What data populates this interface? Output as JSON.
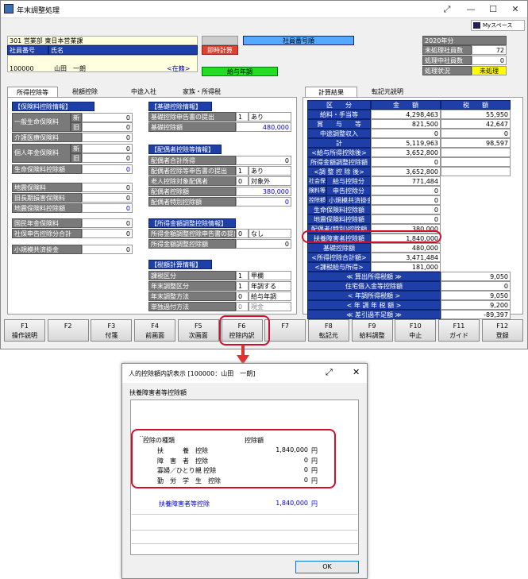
{
  "window": {
    "title": "年末調整処理",
    "myspace": "Myスペース",
    "expand": "⤢",
    "minimize": "—",
    "maximize": "☐",
    "close": "✕"
  },
  "employee": {
    "dept": "301 営業部 東日本営業課",
    "no_label": "社員番号",
    "name_label": "氏名",
    "no": "100000",
    "name": "山田　一朗",
    "status_link": "<在籍>",
    "instant_calc": "即時計算",
    "sort_label": "社員番号順",
    "salary_adjust": "給与年調"
  },
  "summary": {
    "year": "2020年分",
    "rows": [
      {
        "label": "未処理社員数",
        "value": "72"
      },
      {
        "label": "処理中社員数",
        "value": "0"
      },
      {
        "label": "処理状況",
        "value": "未処理"
      }
    ]
  },
  "tabs": [
    "所得控除等",
    "税額控除",
    "中途入社",
    "家族・所得税"
  ],
  "right_tabs": [
    "計算結果",
    "転記元説明"
  ],
  "insurance": {
    "header": "【保険料控除情報】",
    "rows": [
      {
        "label": "一般生命保険料",
        "sub": "新",
        "value": "0"
      },
      {
        "label": "",
        "sub": "旧",
        "value": "0"
      },
      {
        "label": "介護医療保険料",
        "sub": "",
        "value": "0"
      },
      {
        "label": "個人年金保険料",
        "sub": "新",
        "value": "0"
      },
      {
        "label": "",
        "sub": "旧",
        "value": "0"
      },
      {
        "label": "生命保険料控除額",
        "sub": "",
        "value": "0"
      }
    ],
    "eq": [
      {
        "label": "地震保険料",
        "value": "0"
      },
      {
        "label": "旧長期損害保険料",
        "value": "0"
      },
      {
        "label": "地震保険料控除額",
        "value": "0"
      }
    ],
    "ss": [
      {
        "label": "国民年金保険料",
        "value": "0"
      },
      {
        "label": "社保申告控除分合計",
        "value": "0"
      }
    ],
    "small": {
      "label": "小規模共済掛金",
      "value": "0"
    }
  },
  "basic": {
    "header": "【基礎控除情報】",
    "rows": [
      {
        "label": "基礎控除申告書の提出",
        "code": "1",
        "text": "あり"
      },
      {
        "label": "基礎控除額",
        "code": "",
        "text": "480,000"
      }
    ]
  },
  "spouse": {
    "header": "【配偶者控除等情報】",
    "rows": [
      {
        "label": "配偶者合計所得",
        "code": "",
        "text": "0"
      },
      {
        "label": "配偶者控除等申告書の提出",
        "code": "1",
        "text": "あり"
      },
      {
        "label": "老人控除対象配偶者",
        "code": "0",
        "text": "対象外"
      },
      {
        "label": "配偶者控除額",
        "code": "",
        "text": "380,000"
      },
      {
        "label": "配偶者特別控除額",
        "code": "",
        "text": "0"
      }
    ]
  },
  "income_adj": {
    "header": "【所得金額調整控除情報】",
    "rows": [
      {
        "label": "所得金額調整控除申告書の提出",
        "code": "0",
        "text": "なし"
      },
      {
        "label": "所得金額調整控除額",
        "code": "",
        "text": "0"
      }
    ]
  },
  "tax_calc": {
    "header": "【税額計算情報】",
    "rows": [
      {
        "label": "課税区分",
        "code": "1",
        "text": "甲欄"
      },
      {
        "label": "年末調整区分",
        "code": "1",
        "text": "年調する"
      },
      {
        "label": "年末調整方法",
        "code": "0",
        "text": "給与年調"
      },
      {
        "label": "単独過付方法",
        "code": "0",
        "text": "現金"
      }
    ]
  },
  "results": {
    "headers": [
      "区　　分",
      "金　　額",
      "税　　額"
    ],
    "rows": [
      {
        "label": "給料・手当等",
        "amount": "4,298,463",
        "tax": "55,950"
      },
      {
        "label": "賞　　与　　等",
        "amount": "821,500",
        "tax": "42,647"
      },
      {
        "label": "中途調整収入",
        "amount": "0",
        "tax": "0"
      },
      {
        "label": "計",
        "amount": "5,119,963",
        "tax": "98,597"
      },
      {
        "label": "<給与所得控除後>",
        "amount": "3,652,800",
        "tax": ""
      },
      {
        "label": "所得金額調整控除額",
        "amount": "0",
        "tax": ""
      },
      {
        "label": "<調 整 控 除 後>",
        "amount": "3,652,800",
        "tax": ""
      }
    ],
    "social": [
      {
        "group": "社会保",
        "label": "給与控除分",
        "amount": "771,484"
      },
      {
        "group": "険料等",
        "label": "申告控除分",
        "amount": "0"
      },
      {
        "group": "控除額",
        "label": "小規模共済掛金",
        "amount": "0"
      }
    ],
    "rows2": [
      {
        "label": "生命保険料控除額",
        "amount": "0"
      },
      {
        "label": "地震保険料控除額",
        "amount": "0"
      },
      {
        "label": "配偶者(特別)控除額",
        "amount": "380,000"
      },
      {
        "label": "扶養障害者控除額",
        "amount": "1,840,000"
      },
      {
        "label": "基礎控除額",
        "amount": "480,000"
      },
      {
        "label": "<所得控除合計額>",
        "amount": "3,471,484"
      },
      {
        "label": "<課税給与所得>",
        "amount": "181,000"
      }
    ],
    "tax_rows": [
      {
        "label": "≪ 算出所得税額 ≫",
        "tax": "9,050"
      },
      {
        "label": "住宅借入金等控除額",
        "tax": "0"
      },
      {
        "label": "< 年調所得税額 >",
        "tax": "9,050"
      },
      {
        "label": "< 年 調 年 税 額 >",
        "tax": "9,200"
      },
      {
        "label": "≪ 差引過不足額 ≫",
        "tax": "-89,397"
      }
    ]
  },
  "fkeys": [
    {
      "k": "F1",
      "l": "操作説明"
    },
    {
      "k": "F2",
      "l": ""
    },
    {
      "k": "F3",
      "l": "付箋"
    },
    {
      "k": "F4",
      "l": "前画面"
    },
    {
      "k": "F5",
      "l": "次画面"
    },
    {
      "k": "F6",
      "l": "控除内訳"
    },
    {
      "k": "F7",
      "l": ""
    },
    {
      "k": "F8",
      "l": "転記元"
    },
    {
      "k": "F9",
      "l": "給料調整"
    },
    {
      "k": "F10",
      "l": "中止"
    },
    {
      "k": "F11",
      "l": "ガイド"
    },
    {
      "k": "F12",
      "l": "登録"
    }
  ],
  "dialog": {
    "title": "人的控除額内訳表示 [100000：山田　一朗]",
    "group": "扶養障害者等控除額",
    "col1": "控除の種類",
    "col2": "控除額",
    "rows": [
      {
        "label": "扶　　　養　控除",
        "value": "1,840,000",
        "unit": "円"
      },
      {
        "label": "障　害　者　控除",
        "value": "0",
        "unit": "円"
      },
      {
        "label": "寡婦／ひとり親 控除",
        "value": "0",
        "unit": "円"
      },
      {
        "label": "勤　労　学　生　控除",
        "value": "0",
        "unit": "円"
      }
    ],
    "total_label": "扶養障害者等控除",
    "total_value": "1,840,000",
    "total_unit": "円",
    "ok": "OK"
  },
  "colors": {
    "header_blue": "#1f3fa8",
    "highlight_red": "#d0102a",
    "status_yellow": "#ffff00",
    "green": "#22dd22"
  }
}
